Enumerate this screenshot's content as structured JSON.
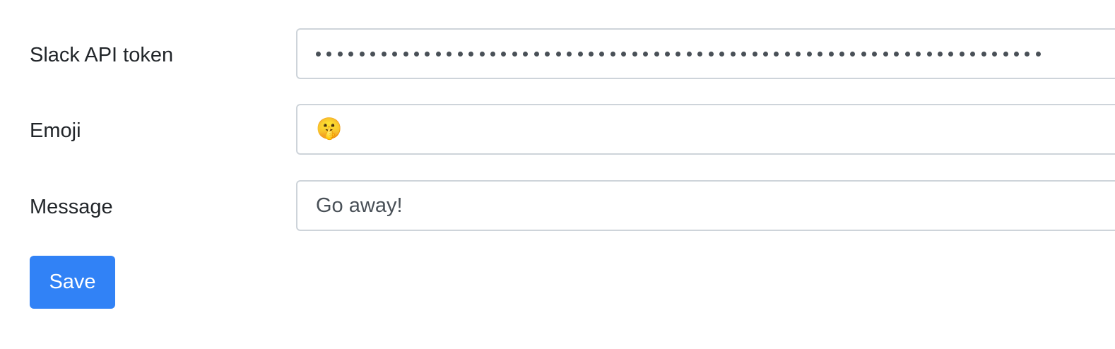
{
  "form": {
    "token": {
      "label": "Slack API token",
      "masked_length": 67
    },
    "emoji": {
      "label": "Emoji",
      "value": "🤫"
    },
    "message": {
      "label": "Message",
      "value": "Go away!"
    },
    "save_label": "Save"
  },
  "colors": {
    "accent": "#3182f6",
    "label_text": "#212529",
    "input_text": "#495057",
    "input_border": "#ced4da"
  }
}
